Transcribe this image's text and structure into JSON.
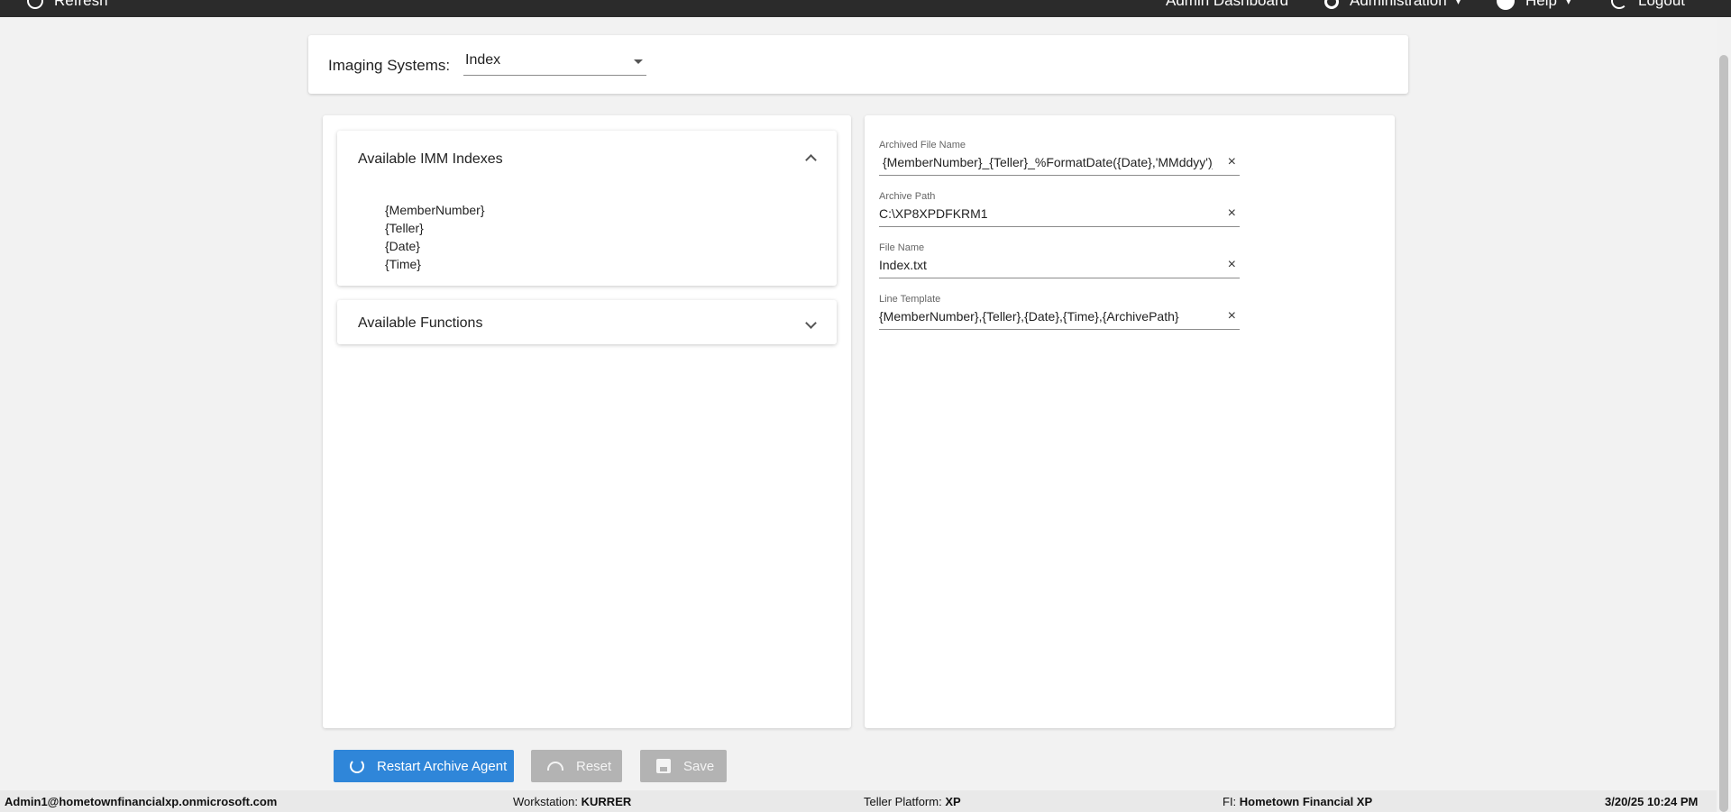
{
  "topbar": {
    "refresh_label": "Refresh",
    "admin_dashboard_label": "Admin Dashboard",
    "administration_label": "Administration",
    "help_label": "Help",
    "logout_label": "Logout"
  },
  "imaging": {
    "label": "Imaging Systems:",
    "selected": "Index"
  },
  "indexes": {
    "title": "Available IMM Indexes",
    "items": [
      "{MemberNumber}",
      "{Teller}",
      "{Date}",
      "{Time}"
    ]
  },
  "functions": {
    "title": "Available Functions"
  },
  "fields": {
    "archived_file_name": {
      "label": "Archived File Name",
      "value": "{MemberNumber}_{Teller}_%FormatDate({Date},'MMddyy')_%FormatTime({Time},'HHmmss').pdf"
    },
    "archive_path": {
      "label": "Archive Path",
      "value": "C:\\XP8XPDFKRM1"
    },
    "file_name": {
      "label": "File Name",
      "value": "Index.txt"
    },
    "line_template": {
      "label": "Line Template",
      "value": "{MemberNumber},{Teller},{Date},{Time},{ArchivePath}"
    },
    "clear_glyph": "×"
  },
  "buttons": {
    "restart": "Restart Archive Agent",
    "reset": "Reset",
    "save": "Save"
  },
  "status": {
    "user": "Admin1@hometownfinancialxp.onmicrosoft.com",
    "workstation_label": "Workstation:",
    "workstation": "KURRER",
    "platform_label": "Teller Platform:",
    "platform": "XP",
    "fi_label": "FI:",
    "fi": "Hometown Financial XP",
    "datetime": "3/20/25 10:24 PM"
  },
  "colors": {
    "topbar": "#2b2b2b",
    "primary_button": "#2f86d9",
    "disabled_button": "#b3b3b3"
  }
}
